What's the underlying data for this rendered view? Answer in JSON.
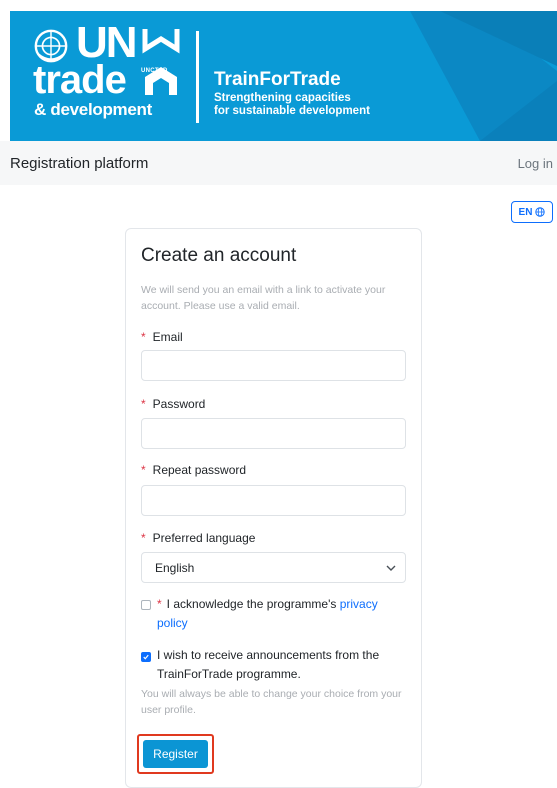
{
  "banner": {
    "un_text": "UN",
    "trade_text": "trade",
    "development_text": "& development",
    "unctad_text": "UNCTAD",
    "program_title": "TrainForTrade",
    "program_subtitle_line1": "Strengthening capacities",
    "program_subtitle_line2": "for sustainable development"
  },
  "nav": {
    "brand": "Registration platform",
    "login_label": "Log in",
    "language_label": "EN"
  },
  "form": {
    "title": "Create an account",
    "note": "We will send you an email with a link to activate your account. Please use a valid email.",
    "required_mark": "*",
    "email_label": "Email",
    "email_value": "",
    "password_label": "Password",
    "password_value": "",
    "repeat_password_label": "Repeat password",
    "repeat_password_value": "",
    "language_label": "Preferred language",
    "language_selected": "English",
    "privacy_text": "I acknowledge the programme's ",
    "privacy_link": "privacy policy",
    "privacy_checked": false,
    "announcements_text": "I wish to receive announcements from the TrainForTrade programme.",
    "announcements_checked": true,
    "hint": "You will always be able to change your choice from your user profile.",
    "register_label": "Register"
  },
  "colors": {
    "banner_blue": "#0a9ad6",
    "primary": "#0d6efd",
    "required": "#dc3545",
    "highlight_border": "#e0391f"
  }
}
